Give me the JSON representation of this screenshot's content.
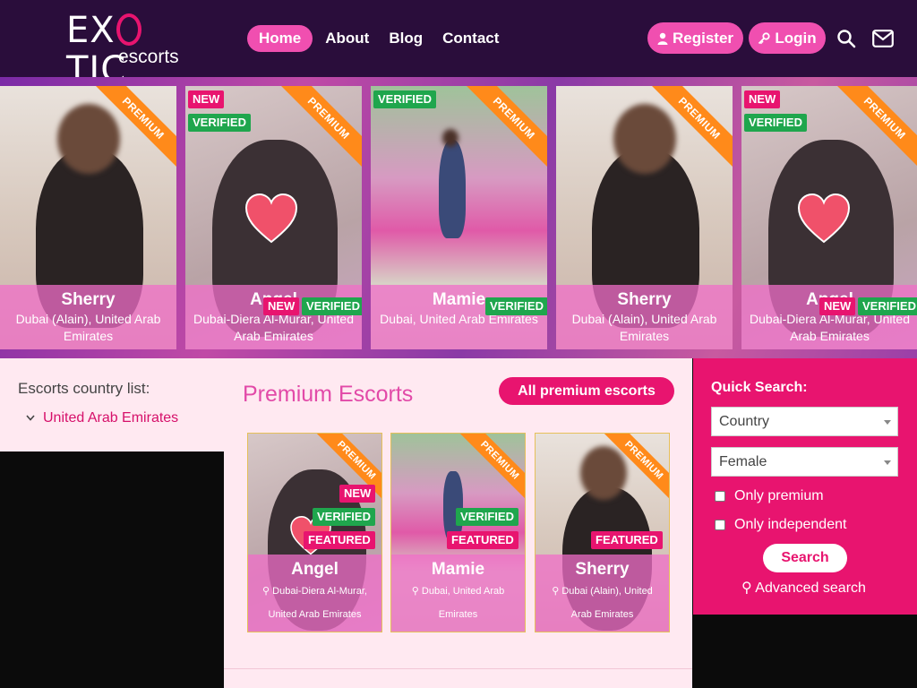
{
  "logo": {
    "main_before": "EX",
    "main_after": "TIC",
    "sub": "escorts"
  },
  "nav": {
    "home": "Home",
    "about": "About",
    "blog": "Blog",
    "contact": "Contact"
  },
  "auth": {
    "register": "Register",
    "login": "Login"
  },
  "badges": {
    "premium": "PREMIUM",
    "new": "NEW",
    "verified": "VERIFIED",
    "featured": "FEATURED"
  },
  "carousel": [
    {
      "name": "Sherry",
      "location": "Dubai (Alain), United Arab Emirates"
    },
    {
      "name": "Angel",
      "location": "Dubai-Diera Al-Murar, United Arab Emirates"
    },
    {
      "name": "Mamie",
      "location": "Dubai, United Arab Emirates"
    },
    {
      "name": "Sherry",
      "location": "Dubai (Alain), United Arab Emirates"
    },
    {
      "name": "Angel",
      "location": "Dubai-Diera Al-Murar, United Arab Emirates"
    }
  ],
  "sidebar": {
    "title": "Escorts country list:",
    "country": "United Arab Emirates"
  },
  "main": {
    "title": "Premium Escorts",
    "all_button": "All premium escorts",
    "cards": [
      {
        "name": "Angel",
        "location": "Dubai-Diera Al-Murar, United Arab Emirates"
      },
      {
        "name": "Mamie",
        "location": "Dubai, United Arab Emirates"
      },
      {
        "name": "Sherry",
        "location": "Dubai (Alain), United Arab Emirates"
      }
    ]
  },
  "quick_search": {
    "title": "Quick Search:",
    "country_select": "Country",
    "gender_select": "Female",
    "only_premium": "Only premium",
    "only_independent": "Only independent",
    "search_button": "Search",
    "advanced": "Advanced search"
  },
  "colors": {
    "header_bg": "#2a0d3b",
    "accent_pink": "#f04fb0",
    "brand_magenta": "#e8146f",
    "verified_green": "#1fa64d",
    "premium_orange": "#ff8a1a",
    "panel_bg": "#ffe9f1"
  }
}
